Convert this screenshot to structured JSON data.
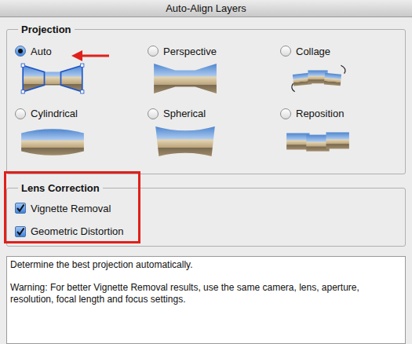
{
  "window": {
    "title": "Auto-Align Layers"
  },
  "projection": {
    "label": "Projection",
    "options": [
      {
        "label": "Auto",
        "selected": true,
        "kind": "auto"
      },
      {
        "label": "Perspective",
        "selected": false,
        "kind": "perspective"
      },
      {
        "label": "Collage",
        "selected": false,
        "kind": "collage"
      },
      {
        "label": "Cylindrical",
        "selected": false,
        "kind": "cylindrical"
      },
      {
        "label": "Spherical",
        "selected": false,
        "kind": "spherical"
      },
      {
        "label": "Reposition",
        "selected": false,
        "kind": "reposition"
      }
    ]
  },
  "lens_correction": {
    "label": "Lens Correction",
    "options": [
      {
        "label": "Vignette Removal",
        "checked": true
      },
      {
        "label": "Geometric Distortion",
        "checked": true
      }
    ]
  },
  "description": {
    "lines": [
      "Determine the best projection automatically.",
      "Warning: For better Vignette Removal results, use the same camera, lens, aperture, resolution, focal length and focus settings."
    ]
  }
}
